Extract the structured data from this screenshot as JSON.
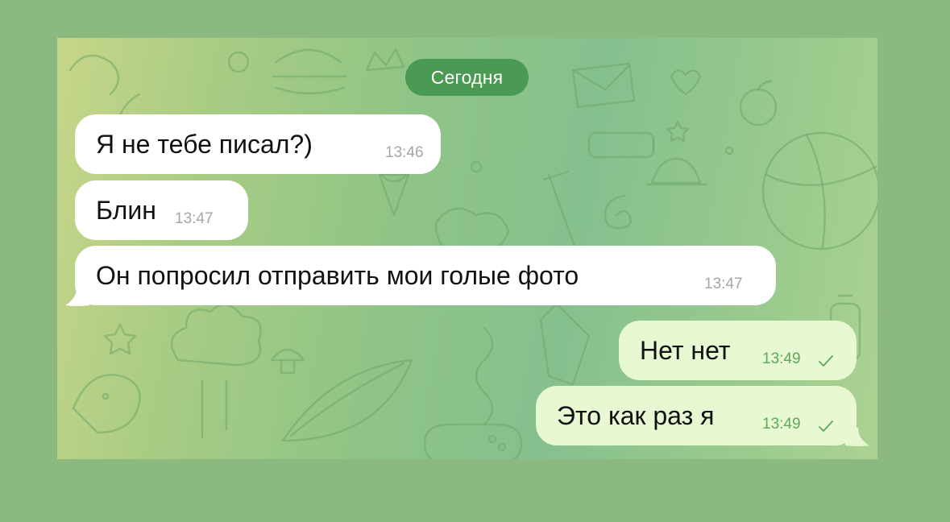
{
  "date_separator": "Сегодня",
  "messages": [
    {
      "direction": "incoming",
      "text": "Я не тебе писал?)",
      "time": "13:46"
    },
    {
      "direction": "incoming",
      "text": "Блин",
      "time": "13:47"
    },
    {
      "direction": "incoming",
      "text": "Он попросил отправить мои голые фото",
      "time": "13:47"
    },
    {
      "direction": "outgoing",
      "text": "Нет нет",
      "time": "13:49",
      "status": "sent-check"
    },
    {
      "direction": "outgoing",
      "text": "Это как раз я",
      "time": "13:49",
      "status": "sent-check"
    }
  ],
  "colors": {
    "outer_background": "#8bb97f",
    "date_pill": "#4b9a53",
    "incoming_bubble": "#ffffff",
    "outgoing_bubble": "#e7f8d3",
    "outgoing_time": "#5ea85a",
    "incoming_time": "#a2a7ab"
  }
}
